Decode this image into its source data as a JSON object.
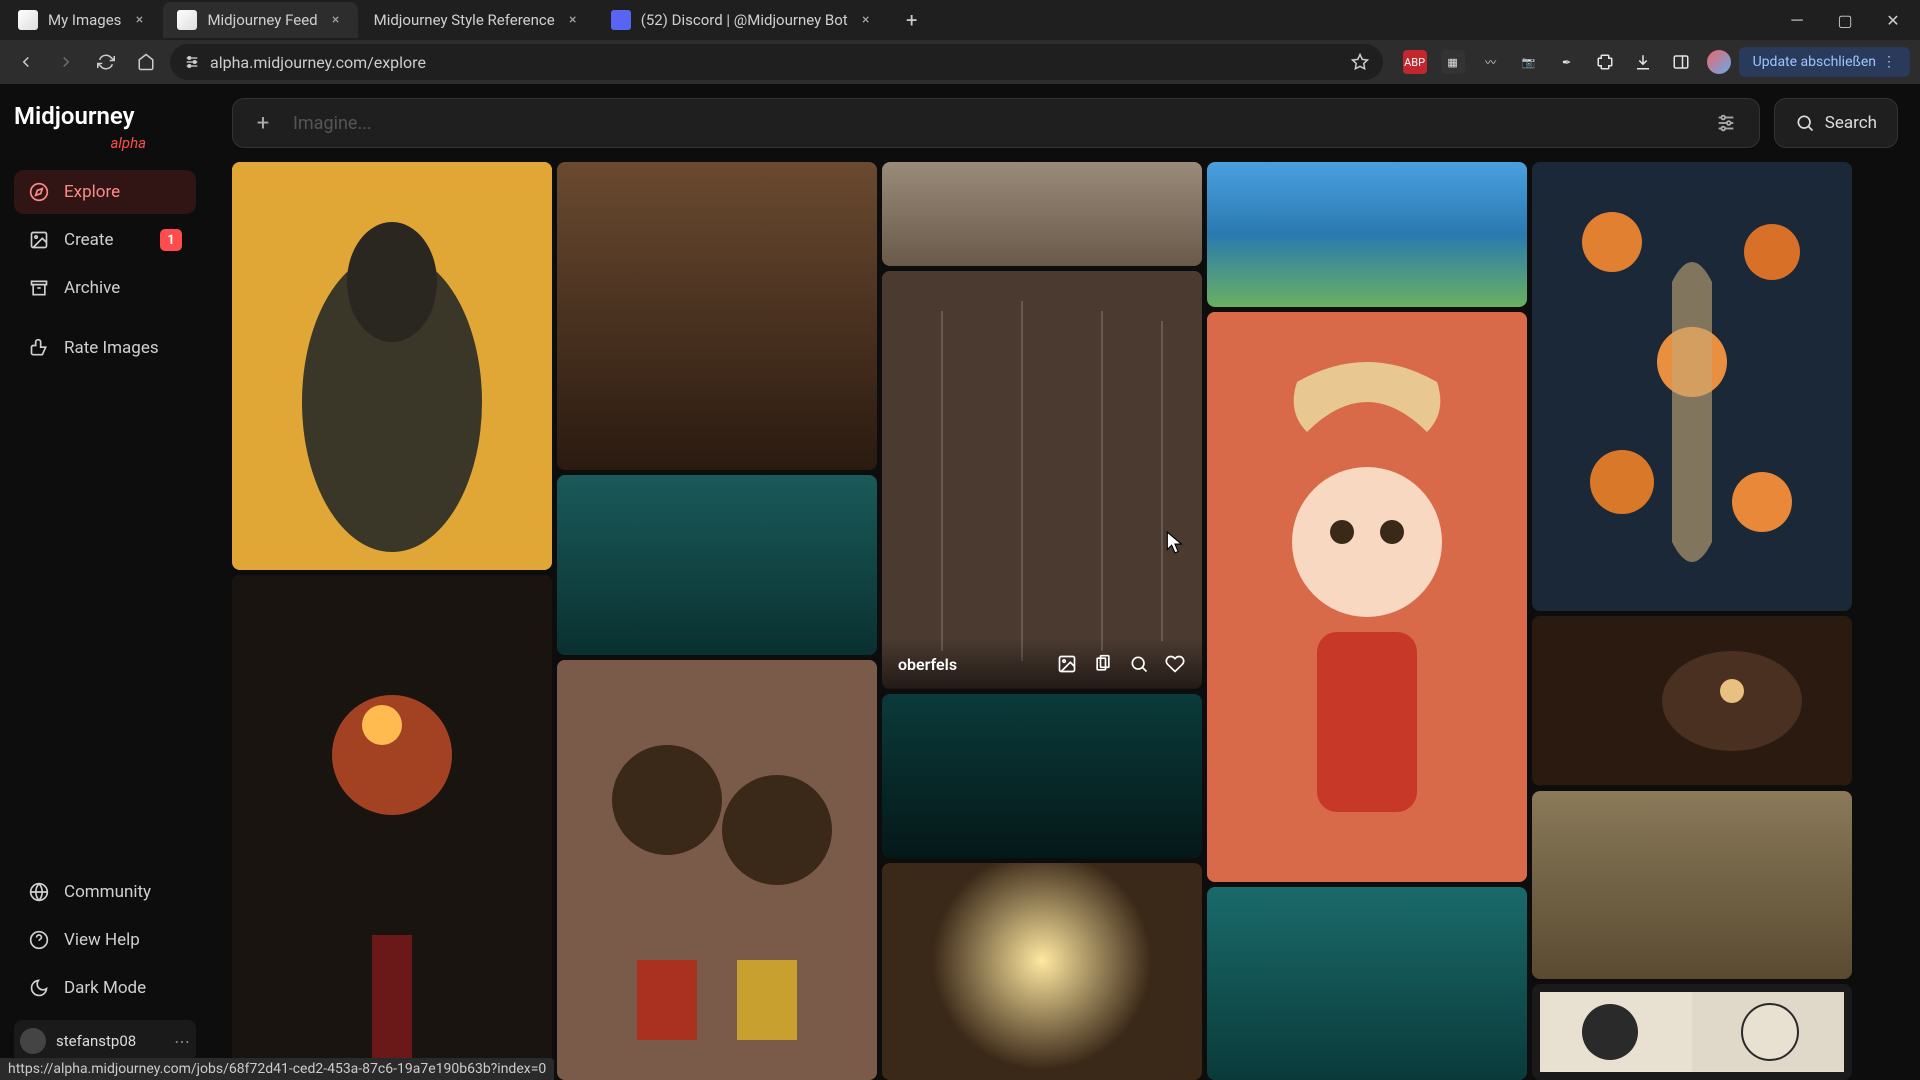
{
  "browser": {
    "tabs": [
      {
        "title": "My Images",
        "active": false
      },
      {
        "title": "Midjourney Feed",
        "active": true
      },
      {
        "title": "Midjourney Style Reference",
        "active": false
      },
      {
        "title": "(52) Discord | @Midjourney Bot",
        "active": false
      }
    ],
    "url": "alpha.midjourney.com/explore",
    "update_label": "Update abschließen"
  },
  "sidebar": {
    "logo": "Midjourney",
    "logo_sub": "alpha",
    "nav": [
      {
        "label": "Explore",
        "active": true
      },
      {
        "label": "Create",
        "badge": "1"
      },
      {
        "label": "Archive"
      },
      {
        "label": "Rate Images"
      }
    ],
    "bottom": [
      {
        "label": "Community"
      },
      {
        "label": "View Help"
      },
      {
        "label": "Dark Mode"
      }
    ],
    "user": "stefanstp08"
  },
  "topbar": {
    "prompt_placeholder": "Imagine...",
    "search_label": "Search"
  },
  "hovered": {
    "author": "oberfels"
  },
  "status_url": "https://alpha.midjourney.com/jobs/68f72d41-ced2-453a-87c6-19a7e190b63b?index=0"
}
